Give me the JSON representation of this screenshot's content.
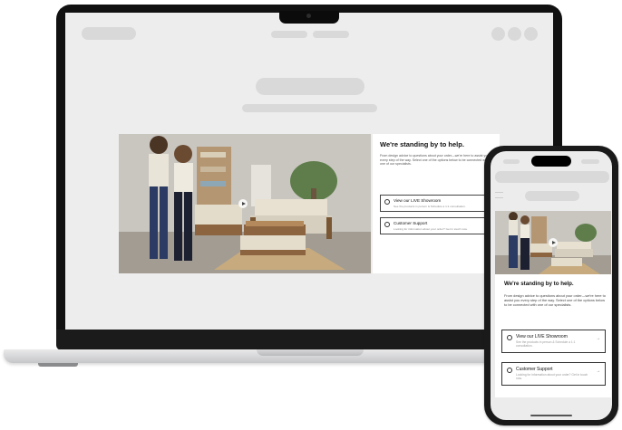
{
  "modal": {
    "title": "We're standing by to help.",
    "description": "From design advice to questions about your order—we're here to assist you every step of the way. Select one of the options below to be connected with one of our specialists.",
    "options": [
      {
        "label": "View our LIVE Showroom",
        "sub": "See the products in person & Schedule a 1:1 consultation.",
        "icon": "location-pin-icon"
      },
      {
        "label": "Customer Support",
        "sub": "Looking for information about your order? Get in touch now.",
        "icon": "support-icon"
      }
    ]
  },
  "colors": {
    "placeholder": "#d9d9d9",
    "screen_bg": "#ededed",
    "device_frame": "#111111"
  }
}
